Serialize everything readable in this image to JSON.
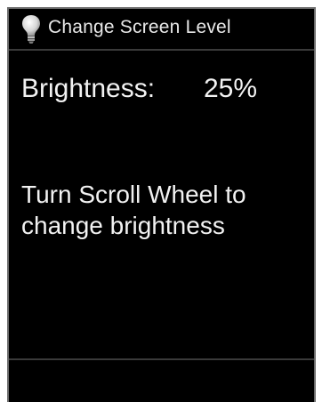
{
  "window": {
    "title": "Change Screen Level",
    "title_icon": "light-bulb-icon"
  },
  "brightness": {
    "label": "Brightness:",
    "value": "25%"
  },
  "instruction": {
    "text": "Turn Scroll Wheel to change brightness"
  },
  "colors": {
    "background": "#000000",
    "text": "#f2f2f2",
    "divider": "#3a3a3a"
  }
}
